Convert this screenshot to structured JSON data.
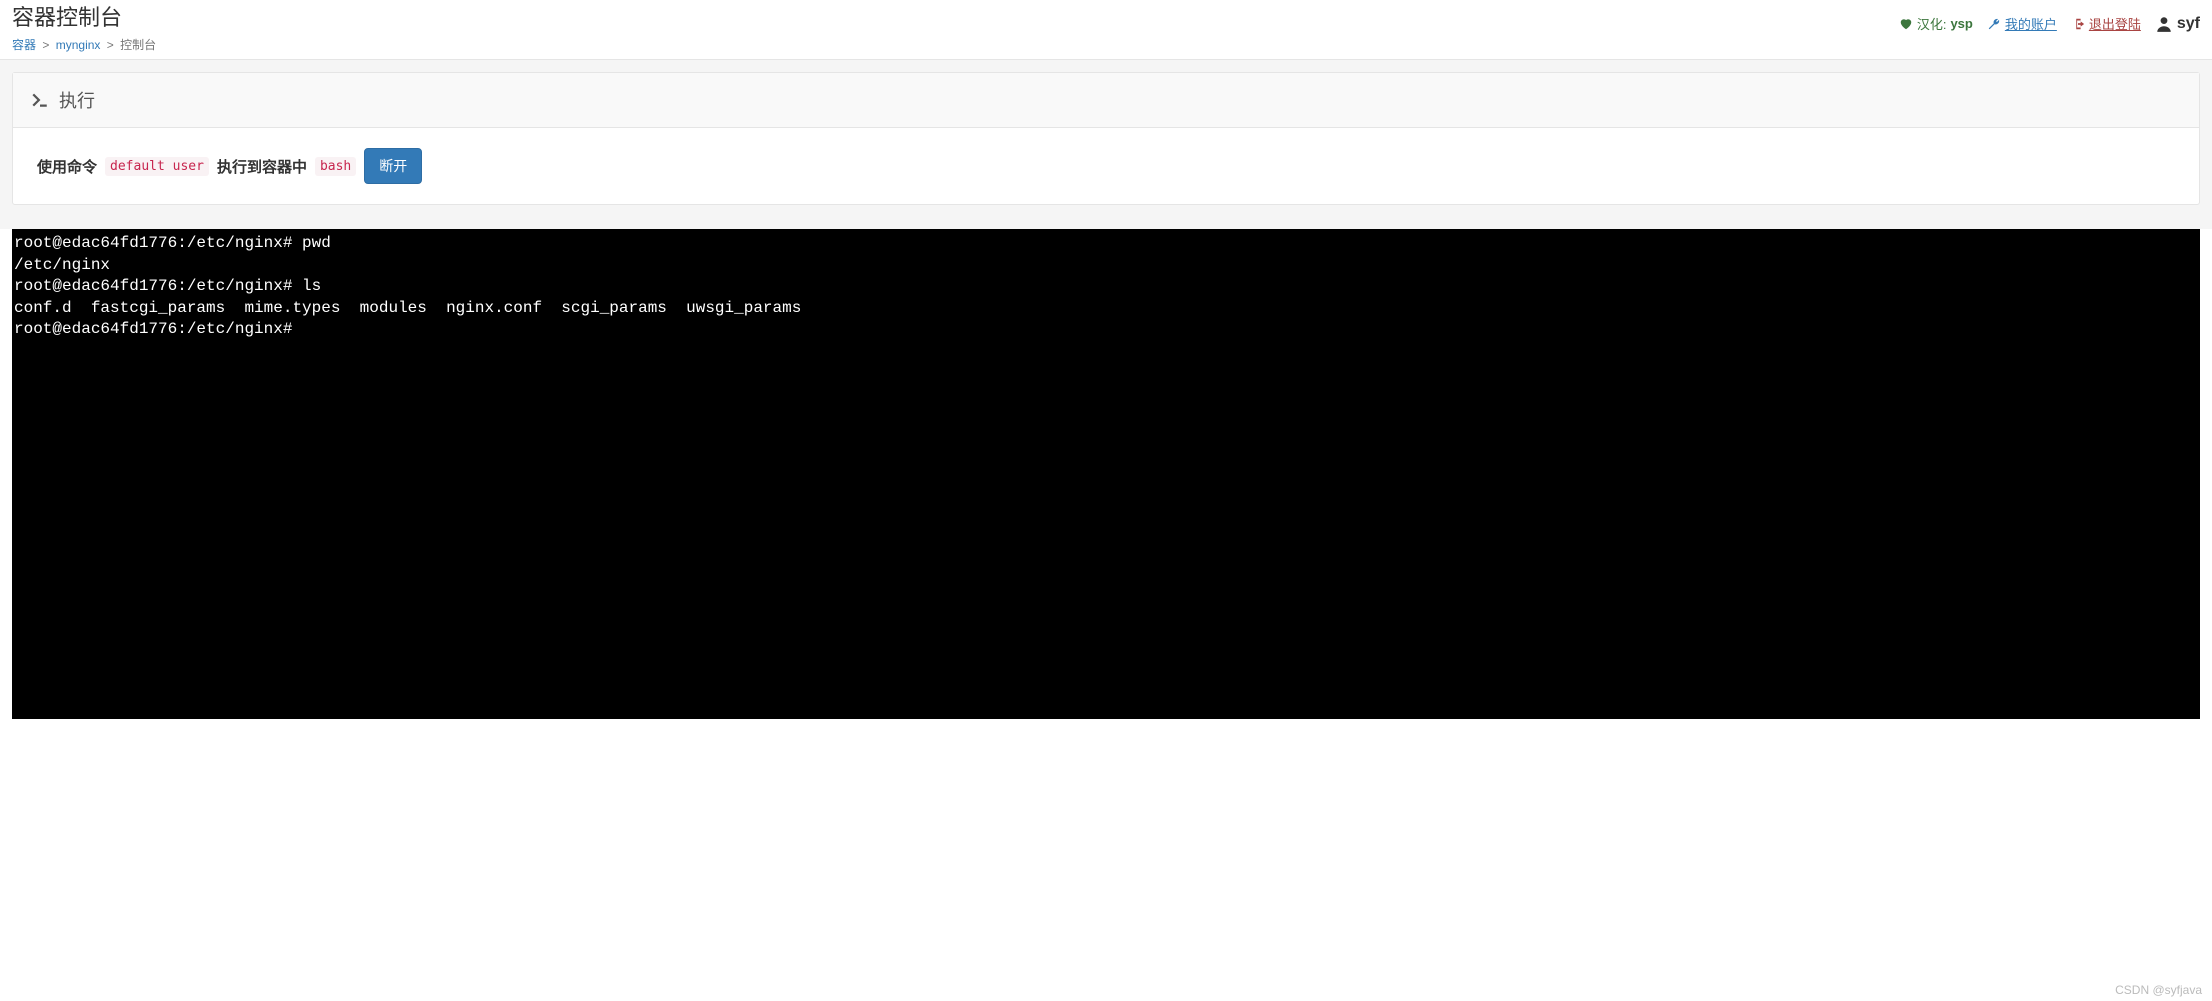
{
  "header": {
    "title": "容器控制台",
    "user": "syf"
  },
  "breadcrumb": {
    "items": [
      {
        "label": "容器",
        "link": true
      },
      {
        "label": "mynginx",
        "link": true
      },
      {
        "label": "控制台",
        "link": false
      }
    ],
    "sep": ">"
  },
  "topnav": {
    "translate": {
      "prefix": "汉化:",
      "name": "ysp"
    },
    "account": "我的账户",
    "logout": "退出登陆"
  },
  "panel": {
    "execute_title": "执行",
    "label_cmd": "使用命令",
    "cmd_value": "default user",
    "label_into": "执行到容器中",
    "shell_value": "bash",
    "disconnect_btn": "断开"
  },
  "terminal": {
    "lines": [
      "root@edac64fd1776:/etc/nginx# pwd",
      "/etc/nginx",
      "root@edac64fd1776:/etc/nginx# ls",
      "conf.d  fastcgi_params  mime.types  modules  nginx.conf  scgi_params  uwsgi_params",
      "root@edac64fd1776:/etc/nginx# "
    ]
  },
  "watermark": "CSDN @syfjava"
}
